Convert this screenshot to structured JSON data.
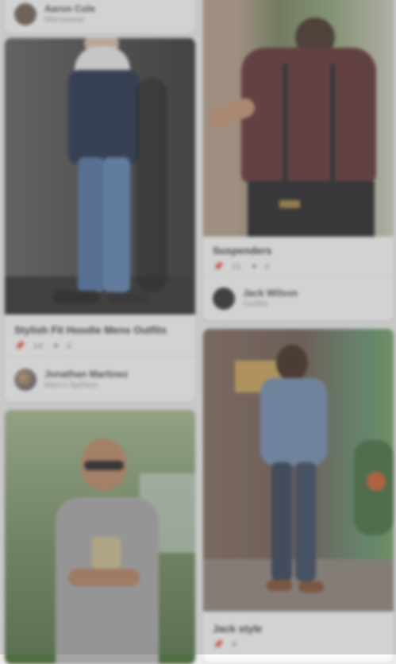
{
  "pins": [
    {
      "id": "pin-top-left-stub",
      "author": {
        "name": "Aaron Cole",
        "sub": "Menswear"
      }
    },
    {
      "id": "pin-hoodie-jeans",
      "title": "Stylish Fit Hoodie Mens Outfits",
      "stats": {
        "repins": "14",
        "likes": "3"
      },
      "author": {
        "name": "Jonathan Martinez",
        "sub": "Men's fashion"
      }
    },
    {
      "id": "pin-maroon-shirt",
      "title": "Suspenders",
      "stats": {
        "repins": "21",
        "likes": "4"
      },
      "author": {
        "name": "Jack Wilson",
        "sub": "Outfits"
      }
    },
    {
      "id": "pin-sunglasses-tee",
      "title": "",
      "stats": {
        "repins": "",
        "likes": ""
      },
      "author": {
        "name": "",
        "sub": ""
      }
    },
    {
      "id": "pin-denim-shirt",
      "title": "Jack style",
      "stats": {
        "repins": "9",
        "likes": ""
      },
      "author": {
        "name": "",
        "sub": ""
      }
    }
  ],
  "colors": {
    "overlay": "#7a7a7a",
    "card": "#fafafa",
    "background": "#ececec"
  }
}
